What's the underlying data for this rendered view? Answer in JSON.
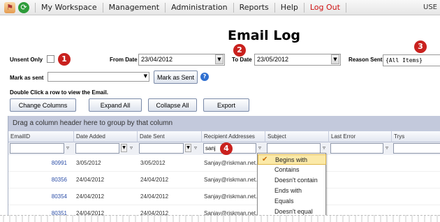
{
  "nav": {
    "items": [
      "My Workspace",
      "Management",
      "Administration",
      "Reports",
      "Help",
      "Log Out"
    ],
    "user": "USE"
  },
  "page_title": "Email Log",
  "filters": {
    "unsent_only_label": "Unsent Only",
    "from_date_label": "From Date",
    "from_date_value": "23/04/2012",
    "to_date_label": "To Date",
    "to_date_value": "23/05/2012",
    "reason_sent_label": "Reason Sent",
    "reason_sent_value": "{All Items}",
    "mark_as_sent_label": "Mark as sent",
    "mark_as_sent_button": "Mark as Sent"
  },
  "badges": [
    "1",
    "2",
    "3",
    "4"
  ],
  "hint": "Double Click a row to view the Email.",
  "toolbar": {
    "change_columns": "Change Columns",
    "expand_all": "Expand All",
    "collapse_all": "Collapse All",
    "export": "Export"
  },
  "grid": {
    "group_prompt": "Drag a column header here to group by that column",
    "columns": [
      "EmailID",
      "Date Added",
      "Date Sent",
      "Recipient Addresses",
      "Subject",
      "Last Error",
      "Trys"
    ],
    "recipient_filter": "sanj",
    "rows": [
      {
        "id": "80991",
        "added": "3/05/2012",
        "sent": "3/05/2012",
        "recipient": "Sanjay@riskman.net."
      },
      {
        "id": "80356",
        "added": "24/04/2012",
        "sent": "24/04/2012",
        "recipient": "Sanjay@riskman.net."
      },
      {
        "id": "80354",
        "added": "24/04/2012",
        "sent": "24/04/2012",
        "recipient": "Sanjay@riskman.net."
      },
      {
        "id": "80351",
        "added": "24/04/2012",
        "sent": "24/04/2012",
        "recipient": "Sanjay@riskman.net."
      }
    ]
  },
  "filter_menu": [
    "Begins with",
    "Contains",
    "Doesn't contain",
    "Ends with",
    "Equals",
    "Doesn't equal"
  ],
  "colors": {
    "badge": "#c9211e",
    "logout": "#d01010",
    "group_bar": "#c3c9dc",
    "menu_selected": "#fbe9a8"
  }
}
